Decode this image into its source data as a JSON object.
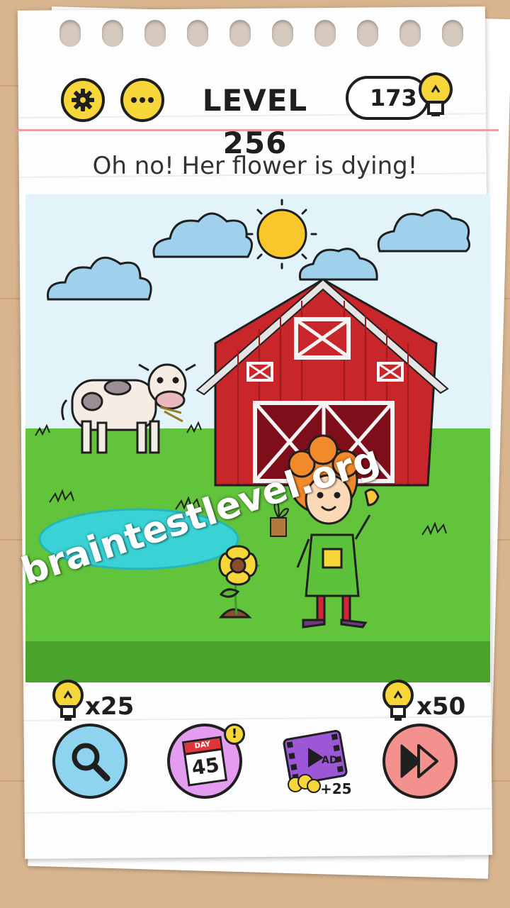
{
  "header": {
    "level_label": "LEVEL 256",
    "hint_count": "173"
  },
  "prompt": "Oh no! Her flower is dying!",
  "watermark": "braintestlevel.org",
  "bottom_bar": {
    "search_cost": "x25",
    "skip_cost": "x50",
    "day_label": "DAY",
    "day_number": "45",
    "ad_label": "AD",
    "ad_reward": "+25"
  },
  "icons": {
    "settings": "gear-icon",
    "more": "more-dots-icon",
    "hint": "lightbulb-icon",
    "search": "magnifier-icon",
    "calendar": "calendar-icon",
    "video": "film-icon",
    "skip": "fast-forward-icon"
  },
  "colors": {
    "button_yellow": "#f7d63a",
    "search_blue": "#8fd4ee",
    "daily_purple": "#e39cf0",
    "skip_pink": "#f3918f",
    "barn_red": "#c8262a",
    "grass_green": "#62c43a",
    "pond_blue": "#39d3d6"
  }
}
